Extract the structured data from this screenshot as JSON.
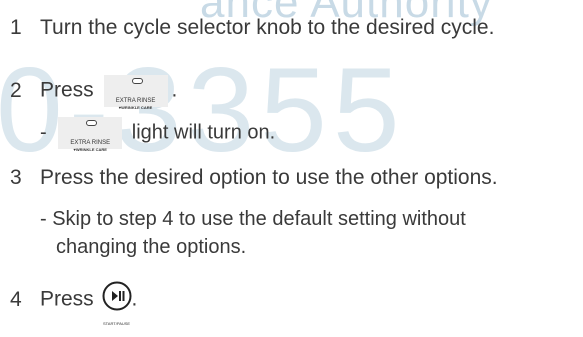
{
  "watermark": {
    "top_text": "ance Authority",
    "big_text": "0-3355"
  },
  "steps": [
    {
      "number": "1",
      "text": "Turn the cycle selector knob to the desired cycle."
    },
    {
      "number": "2",
      "text": "Press",
      "suffix": "."
    },
    {
      "number": "3",
      "text": "Press the desired option to use the other options."
    },
    {
      "number": "4",
      "text": "Press",
      "suffix": "."
    }
  ],
  "step2_sub": {
    "dash": "-",
    "text": "light will turn on."
  },
  "step3_sub": {
    "line1": "- Skip to step 4 to use the default setting without",
    "line2": "changing the options."
  },
  "extra_rinse_button": {
    "label": "EXTRA RINSE",
    "sublabel": "♥WRINKLE CARE"
  },
  "start_button": {
    "label": "START/PAUSE",
    "icon": "play-pause-icon"
  }
}
